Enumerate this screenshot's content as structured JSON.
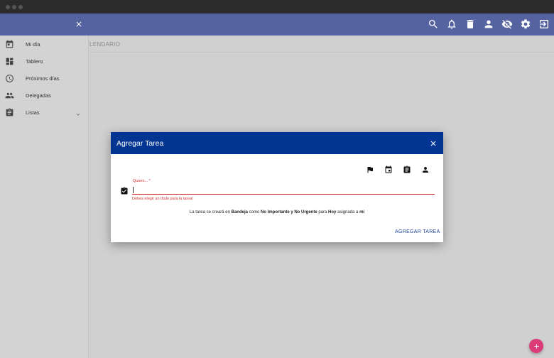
{
  "breadcrumb": "LENDARIO",
  "sidebar": {
    "items": [
      {
        "label": "Mi día",
        "icon": "calendar-today-icon"
      },
      {
        "label": "Tablero",
        "icon": "dashboard-icon"
      },
      {
        "label": "Próximos días",
        "icon": "clock-icon"
      },
      {
        "label": "Delegadas",
        "icon": "people-icon"
      },
      {
        "label": "Listas",
        "icon": "list-icon"
      }
    ]
  },
  "appbar": {
    "icons": [
      "search-icon",
      "bell-icon",
      "trash-icon",
      "person-icon",
      "visibility-off-icon",
      "settings-icon",
      "logout-icon"
    ]
  },
  "dialog": {
    "title": "Agregar Tarea",
    "tools": [
      "flag-icon",
      "event-icon",
      "assignment-icon",
      "person-icon"
    ],
    "field": {
      "label": "Quiero... *",
      "value": "",
      "error": "Debes elegir un título para la tarea!"
    },
    "summary": {
      "t1": "La tarea se creará en ",
      "b1": "Bandeja",
      "t2": " como ",
      "b2": "No Importante y No Urgente",
      "t3": " para ",
      "b3": "Hoy",
      "t4": " asignada a ",
      "b4": "mi"
    },
    "submit_label": "AGREGAR TAREA"
  },
  "colors": {
    "appbar": "#5563a0",
    "dialog_header": "#023592",
    "error": "#d32f2f",
    "accent": "#1a3e93",
    "fab": "#dc3c78"
  }
}
